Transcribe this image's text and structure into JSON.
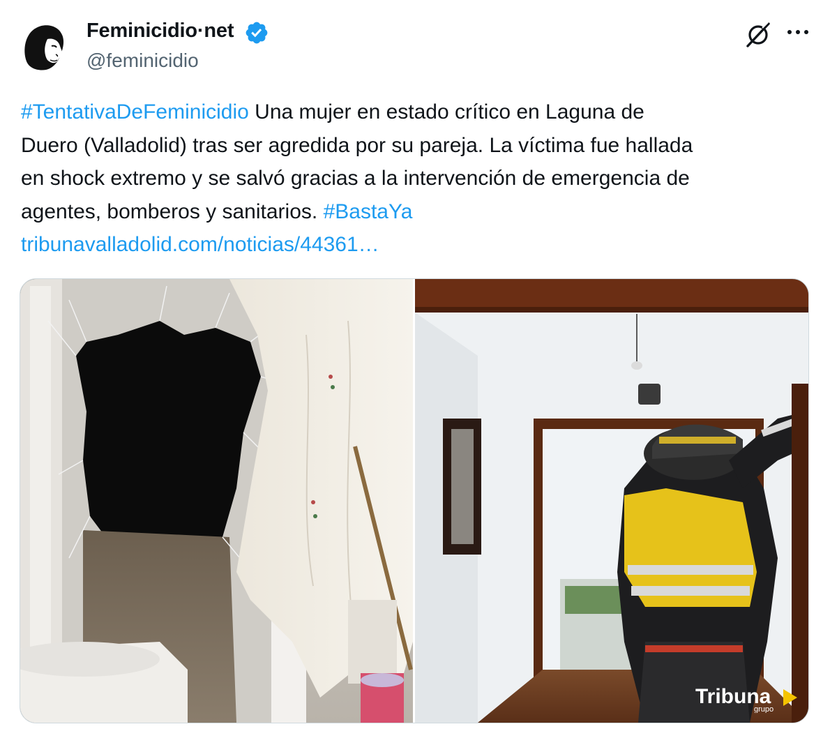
{
  "author": {
    "display_name": "Feminicidio·net",
    "handle": "@feminicidio"
  },
  "icons": {
    "avatar": "woman-silhouette-logo",
    "verified": "verified-badge-icon",
    "grok": "grok-icon",
    "more": "more-icon"
  },
  "tweet": {
    "hashtag1": "#TentativaDeFeminicidio",
    "line1_text": " Una mujer en estado crítico en Laguna de",
    "line2": "Duero (Valladolid) tras ser agredida por su pareja. La víctima fue hallada",
    "line3": "en shock extremo y se salvó gracias a la intervención de emergencia de",
    "line4_text": "agentes, bomberos y sanitarios. ",
    "hashtag2": "#BastaYa",
    "url": "tribunavalladolid.com/noticias/44361…"
  },
  "media": {
    "watermark_main": "Tribuna",
    "watermark_sub": "grupo"
  },
  "colors": {
    "link": "#1d9bf0",
    "verified": "#1d9bf0",
    "text": "#0f1419",
    "secondary": "#536471"
  }
}
